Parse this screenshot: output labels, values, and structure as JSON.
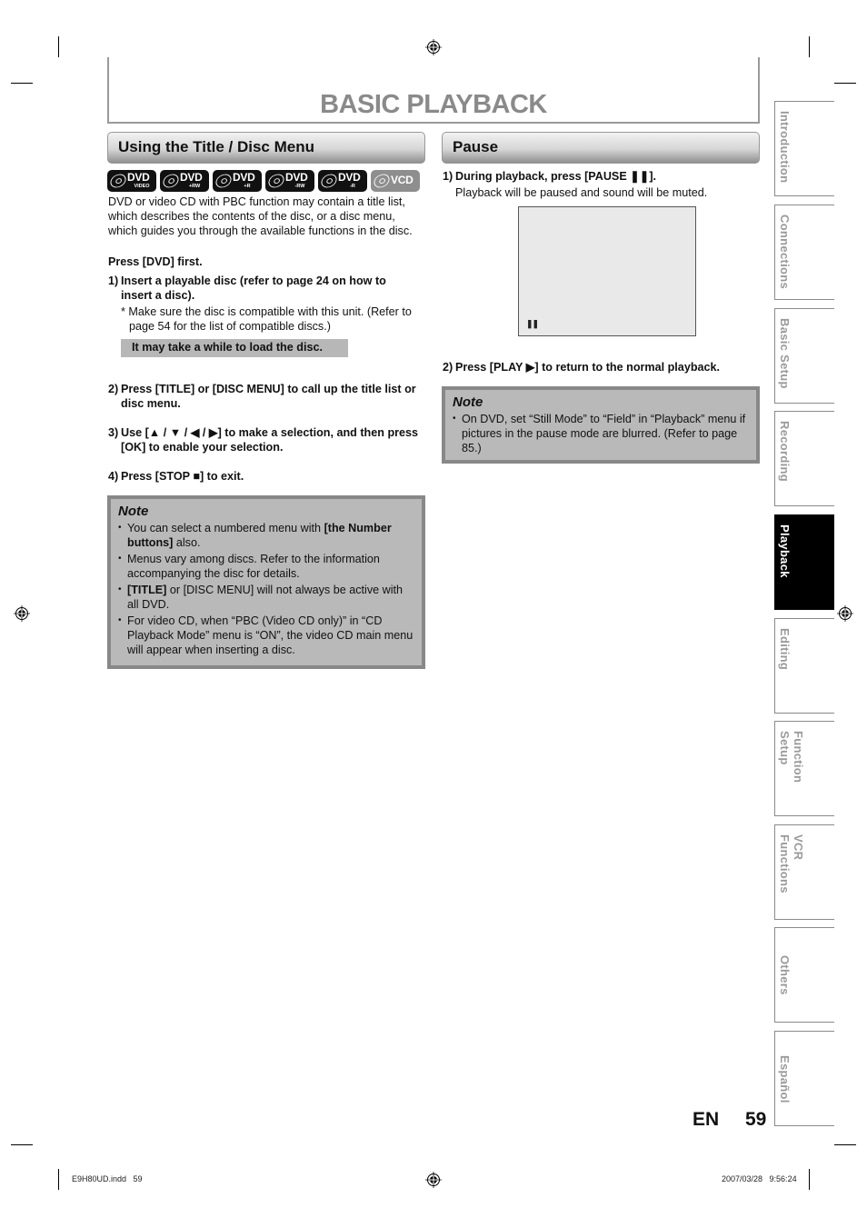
{
  "page": {
    "title": "BASIC PLAYBACK",
    "language": "EN",
    "page_number": "59"
  },
  "left_section": {
    "heading": "Using the Title / Disc Menu",
    "disc_icons": [
      {
        "label": "DVD",
        "sub": "VIDEO"
      },
      {
        "label": "DVD",
        "sub": "+RW"
      },
      {
        "label": "DVD",
        "sub": "+R"
      },
      {
        "label": "DVD",
        "sub": "-RW"
      },
      {
        "label": "DVD",
        "sub": "-R"
      },
      {
        "label": "VCD",
        "sub": ""
      }
    ],
    "intro": "DVD or video CD with PBC function may contain a title list, which describes the contents of the disc, or a disc menu, which guides you through the available functions in the disc.",
    "press_first": "Press [DVD] first.",
    "steps": [
      {
        "num": "1)",
        "text": "Insert a playable disc (refer to page 24 on how to insert a disc)."
      },
      {
        "num": "2)",
        "text": "Press [TITLE] or [DISC MENU] to call up the title list or disc menu."
      },
      {
        "num": "3)",
        "text": "Use [▲ / ▼ / ◀ / ▶] to make a selection, and then press [OK] to enable your selection."
      },
      {
        "num": "4)",
        "text": "Press [STOP ■] to exit."
      }
    ],
    "step1_note": "* Make sure the disc is compatible with this unit. (Refer to page 54 for the list of compatible discs.)",
    "highlight": "It may take a while to load the disc.",
    "note": {
      "title": "Note",
      "items": [
        {
          "pre": "You can select a numbered menu with ",
          "bold": "[the Number buttons]",
          "post": " also."
        },
        {
          "pre": "Menus vary among discs. Refer to the information accompanying the disc for details.",
          "bold": "",
          "post": ""
        },
        {
          "pre": "",
          "bold": "[TITLE]",
          "post": " or [DISC MENU] will not always be active with all DVD."
        },
        {
          "pre": "For video CD, when “PBC (Video CD only)” in “CD Playback Mode” menu is “ON”, the video CD main menu will appear when inserting a disc.",
          "bold": "",
          "post": ""
        }
      ]
    }
  },
  "right_section": {
    "heading": "Pause",
    "steps": [
      {
        "num": "1)",
        "text": "During playback, press [PAUSE ❚❚].",
        "sub": "Playback will be paused and sound will be muted."
      },
      {
        "num": "2)",
        "text": "Press [PLAY ▶] to return to the normal playback.",
        "sub": ""
      }
    ],
    "screen_indicator": "❚❚",
    "note": {
      "title": "Note",
      "items": [
        "On DVD, set “Still Mode” to “Field” in “Playback” menu if pictures in the pause mode are blurred. (Refer to page 85.)"
      ]
    }
  },
  "side_tabs": [
    {
      "label": "Introduction",
      "active": false
    },
    {
      "label": "Connections",
      "active": false
    },
    {
      "label": "Basic Setup",
      "active": false
    },
    {
      "label": "Recording",
      "active": false
    },
    {
      "label": "Playback",
      "active": true
    },
    {
      "label": "Editing",
      "active": false
    },
    {
      "label": "Function Setup",
      "active": false
    },
    {
      "label": "VCR Functions",
      "active": false
    },
    {
      "label": "Others",
      "active": false
    },
    {
      "label": "Español",
      "active": false
    }
  ],
  "slug": {
    "file": "E9H80UD.indd   59",
    "datetime": "2007/03/28   9:56:24"
  }
}
